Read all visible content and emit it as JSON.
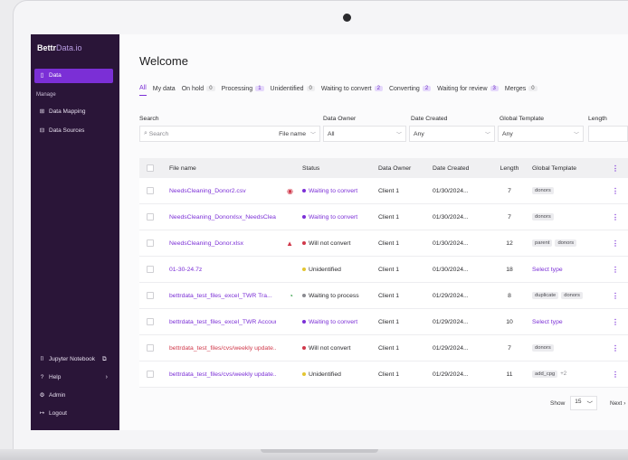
{
  "sidebar": {
    "logo_bold": "Bettr",
    "logo_thin": "Data.io",
    "items": [
      {
        "label": "Data",
        "icon": "file-icon"
      },
      {
        "label": "Data Mapping",
        "icon": "grid-icon"
      },
      {
        "label": "Data Sources",
        "icon": "database-icon"
      }
    ],
    "section": "Manage",
    "bottom": [
      {
        "label": "Jupyter Notebook",
        "icon": "terminal-icon"
      },
      {
        "label": "Help",
        "icon": "help-icon"
      },
      {
        "label": "Admin",
        "icon": "gear-icon"
      },
      {
        "label": "Logout",
        "icon": "logout-icon"
      }
    ]
  },
  "main": {
    "title": "Welcome",
    "tabs": [
      {
        "label": "All",
        "count": ""
      },
      {
        "label": "My data",
        "count": ""
      },
      {
        "label": "On hold",
        "count": "0"
      },
      {
        "label": "Processing",
        "count": "1"
      },
      {
        "label": "Unidentified",
        "count": "0"
      },
      {
        "label": "Waiting to convert",
        "count": "2"
      },
      {
        "label": "Converting",
        "count": "2"
      },
      {
        "label": "Waiting for review",
        "count": "3"
      },
      {
        "label": "Merges",
        "count": "0"
      }
    ],
    "filters": {
      "search_label": "Search",
      "search_placeholder": "Search",
      "search_scope": "File name",
      "owner_label": "Data Owner",
      "owner_value": "All",
      "date_label": "Date Created",
      "date_value": "Any",
      "template_label": "Global Template",
      "template_value": "Any",
      "length_label": "Length"
    },
    "table": {
      "headers": {
        "name": "File name",
        "status": "Status",
        "owner": "Data Owner",
        "date": "Date Created",
        "length": "Length",
        "template": "Global Template"
      },
      "rows": [
        {
          "name": "NeedsCleaning_Donor2.csv",
          "flag": "◉",
          "flag_color": "#d0384a",
          "red": false,
          "status": "Waiting to convert",
          "status_color": "#7b2fd6",
          "dot": "#7b2fd6",
          "owner": "Client 1",
          "date": "01/30/2024...",
          "length": "7",
          "tags": [
            "donors"
          ],
          "select": "",
          "more": ""
        },
        {
          "name": "NeedsCleaning_Donorxlsx_NeedsClean...",
          "flag": "",
          "flag_color": "",
          "red": false,
          "status": "Waiting to convert",
          "status_color": "#7b2fd6",
          "dot": "#7b2fd6",
          "owner": "Client 1",
          "date": "01/30/2024...",
          "length": "7",
          "tags": [
            "donors"
          ],
          "select": "",
          "more": ""
        },
        {
          "name": "NeedsCleaning_Donor.xlsx",
          "flag": "▲",
          "flag_color": "#d0384a",
          "red": false,
          "status": "Will not convert",
          "status_color": "#2b2b2e",
          "dot": "#d0384a",
          "owner": "Client 1",
          "date": "01/30/2024...",
          "length": "12",
          "tags": [
            "parent",
            "donors"
          ],
          "select": "",
          "more": ""
        },
        {
          "name": "01-30-24.7z",
          "flag": "",
          "flag_color": "",
          "red": false,
          "status": "Unidentified",
          "status_color": "#2b2b2e",
          "dot": "#e3c531",
          "owner": "Client 1",
          "date": "01/30/2024...",
          "length": "18",
          "tags": [],
          "select": "Select type",
          "more": ""
        },
        {
          "name": "bettrdata_test_files_excel_TWR Tra...",
          "flag": "◔",
          "flag_color": "#2f9e44",
          "red": false,
          "status": "Waiting to process",
          "status_color": "#2b2b2e",
          "dot": "#8a8a90",
          "owner": "Client 1",
          "date": "01/29/2024...",
          "length": "8",
          "tags": [
            "duplicate",
            "donors"
          ],
          "select": "",
          "more": ""
        },
        {
          "name": "bettrdata_test_files_excel_TWR Accoun...",
          "flag": "",
          "flag_color": "",
          "red": false,
          "status": "Waiting to convert",
          "status_color": "#7b2fd6",
          "dot": "#7b2fd6",
          "owner": "Client 1",
          "date": "01/29/2024...",
          "length": "10",
          "tags": [],
          "select": "Select type",
          "more": ""
        },
        {
          "name": "bettrdata_test_files/cvs/weekly update...",
          "flag": "",
          "flag_color": "",
          "red": true,
          "status": "Will not convert",
          "status_color": "#2b2b2e",
          "dot": "#d0384a",
          "owner": "Client 1",
          "date": "01/29/2024...",
          "length": "7",
          "tags": [
            "donors"
          ],
          "select": "",
          "more": ""
        },
        {
          "name": "bettrdata_test_files/cvs/weekly update...",
          "flag": "",
          "flag_color": "",
          "red": false,
          "status": "Unidentified",
          "status_color": "#2b2b2e",
          "dot": "#e3c531",
          "owner": "Client 1",
          "date": "01/29/2024...",
          "length": "11",
          "tags": [
            "add_cpg"
          ],
          "select": "",
          "more": "+2"
        }
      ]
    },
    "pager": {
      "show_label": "Show",
      "show_value": "15",
      "next_label": "Next"
    }
  },
  "colors": {
    "accent": "#7b2fd6",
    "sidebar": "#2a1538",
    "danger": "#d0384a",
    "warning": "#e3c531"
  }
}
